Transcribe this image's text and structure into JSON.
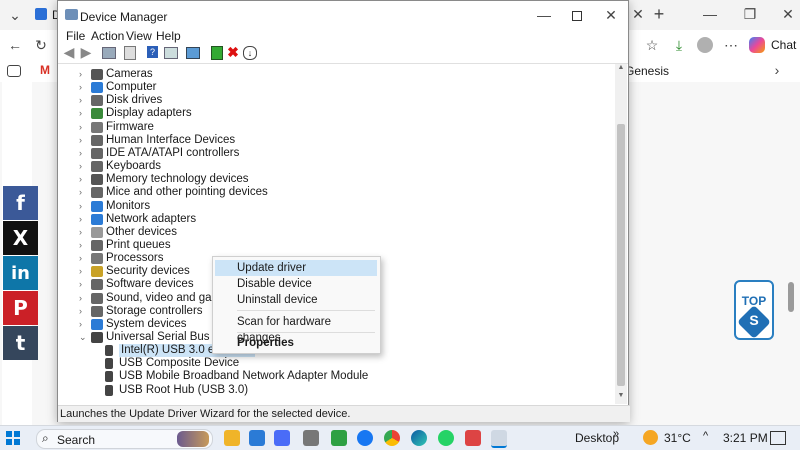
{
  "browser": {
    "tab_letter": "D",
    "partial_tab_text": "Genesis",
    "copilot_label": "Chat",
    "gmail_letter": "M"
  },
  "social": [
    {
      "glyph": "f",
      "color": "#3b5998"
    },
    {
      "glyph": "X",
      "color": "#111111"
    },
    {
      "glyph": "in",
      "color": "#0e76a8"
    },
    {
      "glyph": "P",
      "color": "#cb2027"
    },
    {
      "glyph": "t",
      "color": "#35465c"
    }
  ],
  "top_button": {
    "label": "TOP",
    "badge": "S"
  },
  "window": {
    "title": "Device Manager",
    "menu": [
      "File",
      "Action",
      "View",
      "Help"
    ],
    "status": "Launches the Update Driver Wizard for the selected device."
  },
  "tree": [
    {
      "label": "Cameras",
      "icon_color": "#555"
    },
    {
      "label": "Computer",
      "icon_color": "#2b7bd6"
    },
    {
      "label": "Disk drives",
      "icon_color": "#666"
    },
    {
      "label": "Display adapters",
      "icon_color": "#3a8a3a"
    },
    {
      "label": "Firmware",
      "icon_color": "#777"
    },
    {
      "label": "Human Interface Devices",
      "icon_color": "#666"
    },
    {
      "label": "IDE ATA/ATAPI controllers",
      "icon_color": "#666"
    },
    {
      "label": "Keyboards",
      "icon_color": "#666"
    },
    {
      "label": "Memory technology devices",
      "icon_color": "#555"
    },
    {
      "label": "Mice and other pointing devices",
      "icon_color": "#666"
    },
    {
      "label": "Monitors",
      "icon_color": "#2b7bd6"
    },
    {
      "label": "Network adapters",
      "icon_color": "#2b7bd6"
    },
    {
      "label": "Other devices",
      "icon_color": "#999"
    },
    {
      "label": "Print queues",
      "icon_color": "#666"
    },
    {
      "label": "Processors",
      "icon_color": "#777"
    },
    {
      "label": "Security devices",
      "icon_color": "#c9a227"
    },
    {
      "label": "Software devices",
      "icon_color": "#666"
    },
    {
      "label": "Sound, video and game con",
      "icon_color": "#666"
    },
    {
      "label": "Storage controllers",
      "icon_color": "#666"
    },
    {
      "label": "System devices",
      "icon_color": "#2b7bd6"
    },
    {
      "label": "Universal Serial Bus controlle",
      "icon_color": "#444"
    }
  ],
  "usb_children": [
    "Intel(R) USB 3.0 eXtensib",
    "USB Composite Device",
    "USB Mobile Broadband Network Adapter Module",
    "USB Root Hub (USB 3.0)"
  ],
  "context_menu": [
    "Update driver",
    "Disable device",
    "Uninstall device",
    "Scan for hardware changes",
    "Properties"
  ],
  "taskbar": {
    "search": "Search",
    "desktop": "Desktop",
    "temperature": "31°C",
    "time": "3:21 PM"
  }
}
